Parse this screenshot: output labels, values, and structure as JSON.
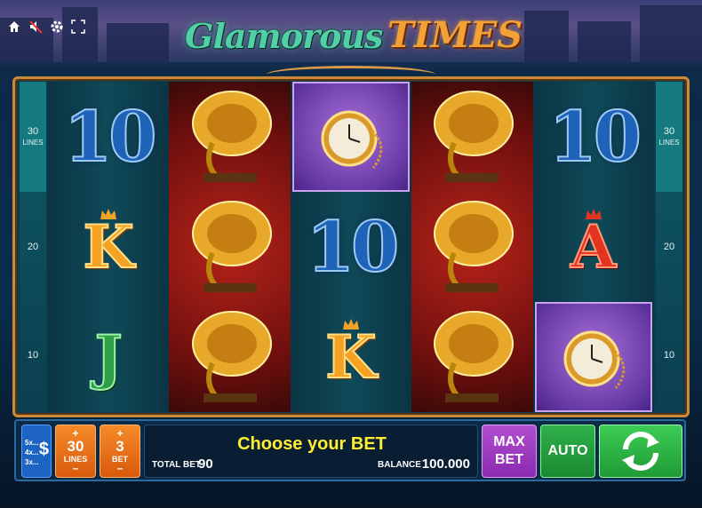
{
  "game": {
    "title_part1": "Glamorous",
    "title_part2": "TIMES"
  },
  "toolbar": {
    "icons": [
      "home-icon",
      "sound-muted-icon",
      "settings-icon",
      "fullscreen-icon"
    ]
  },
  "side_labels": {
    "top_label": "30",
    "top_sub": "LINES",
    "mid_label": "20",
    "bottom_label": "10"
  },
  "reels": [
    [
      "10",
      "K",
      "J"
    ],
    [
      "gramophone",
      "gramophone",
      "gramophone"
    ],
    [
      "pocket-watch",
      "10",
      "K"
    ],
    [
      "gramophone",
      "gramophone",
      "gramophone"
    ],
    [
      "10",
      "A",
      "pocket-watch"
    ]
  ],
  "controls": {
    "paytable_lines": [
      "5x...",
      "4x...",
      "3x..."
    ],
    "paytable_symbol": "$",
    "lines_value": "30",
    "lines_label": "LINES",
    "bet_value": "3",
    "bet_label": "BET",
    "plus": "+",
    "minus": "–",
    "message": "Choose your BET",
    "total_bet_label": "TOTAL BET",
    "total_bet_value": "90",
    "balance_label": "BALANCE",
    "balance_value": "100.000",
    "max_bet_line1": "MAX",
    "max_bet_line2": "BET",
    "auto_label": "AUTO"
  },
  "colors": {
    "accent_orange": "#f68a2a",
    "accent_purple": "#b24ed0",
    "accent_green": "#2fb04a",
    "message_yellow": "#ffee33",
    "frame_gold": "#c98a3b"
  }
}
